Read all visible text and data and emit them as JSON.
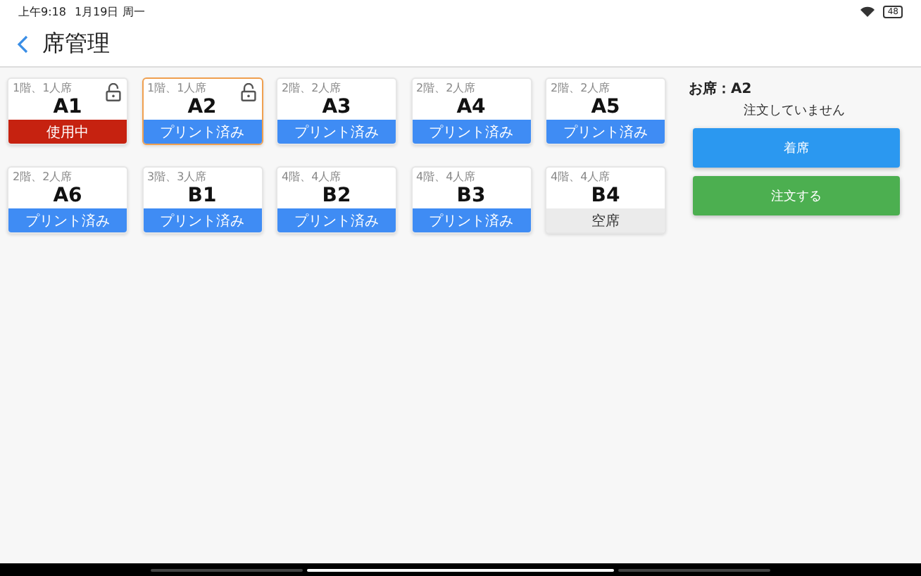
{
  "status_bar": {
    "time": "上午9:18",
    "date": "1月19日 周一",
    "battery": "48"
  },
  "header": {
    "title": "席管理"
  },
  "seats": [
    {
      "info": "1階、1人席",
      "name": "A1",
      "locked": true,
      "selected": false,
      "kind": "in_use",
      "status": "使用中"
    },
    {
      "info": "1階、1人席",
      "name": "A2",
      "locked": true,
      "selected": true,
      "kind": "printed",
      "status": "プリント済み"
    },
    {
      "info": "2階、2人席",
      "name": "A3",
      "locked": false,
      "selected": false,
      "kind": "printed",
      "status": "プリント済み"
    },
    {
      "info": "2階、2人席",
      "name": "A4",
      "locked": false,
      "selected": false,
      "kind": "printed",
      "status": "プリント済み"
    },
    {
      "info": "2階、2人席",
      "name": "A5",
      "locked": false,
      "selected": false,
      "kind": "printed",
      "status": "プリント済み"
    },
    {
      "info": "2階、2人席",
      "name": "A6",
      "locked": false,
      "selected": false,
      "kind": "printed",
      "status": "プリント済み"
    },
    {
      "info": "3階、3人席",
      "name": "B1",
      "locked": false,
      "selected": false,
      "kind": "printed",
      "status": "プリント済み"
    },
    {
      "info": "4階、4人席",
      "name": "B2",
      "locked": false,
      "selected": false,
      "kind": "printed",
      "status": "プリント済み"
    },
    {
      "info": "4階、4人席",
      "name": "B3",
      "locked": false,
      "selected": false,
      "kind": "printed",
      "status": "プリント済み"
    },
    {
      "info": "4階、4人席",
      "name": "B4",
      "locked": false,
      "selected": false,
      "kind": "vacant",
      "status": "空席"
    }
  ],
  "panel": {
    "seat_label": "お席：A2",
    "order_status": "注文していません",
    "buttons": [
      {
        "label": "着席",
        "kind": "primary"
      },
      {
        "label": "注文する",
        "kind": "success"
      }
    ]
  }
}
